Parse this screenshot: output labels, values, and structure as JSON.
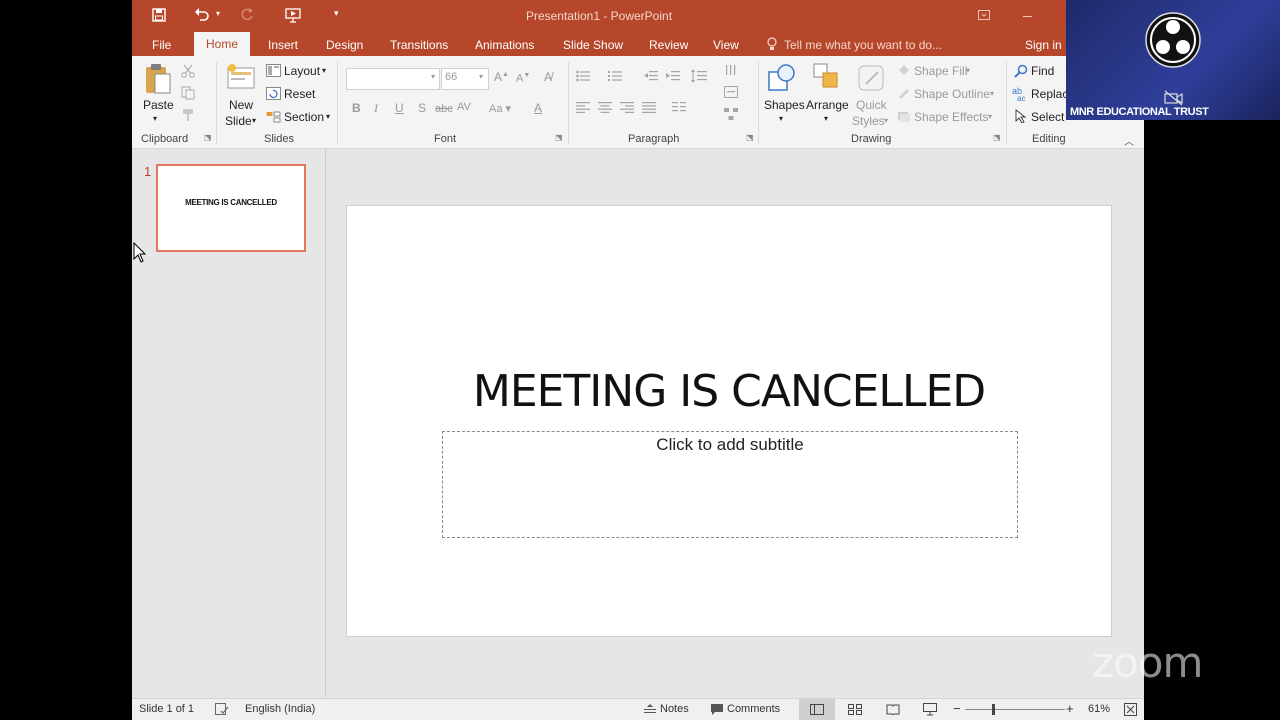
{
  "window": {
    "title": "Presentation1 - PowerPoint",
    "sign_in": "Sign in"
  },
  "tabs": [
    "File",
    "Home",
    "Insert",
    "Design",
    "Transitions",
    "Animations",
    "Slide Show",
    "Review",
    "View"
  ],
  "tell_me": "Tell me what you want to do...",
  "ribbon": {
    "clipboard": {
      "paste": "Paste",
      "label": "Clipboard"
    },
    "slides": {
      "new_slide_1": "New",
      "new_slide_2": "Slide",
      "layout": "Layout",
      "reset": "Reset",
      "section": "Section",
      "label": "Slides"
    },
    "font": {
      "size": "66",
      "label": "Font"
    },
    "paragraph": {
      "label": "Paragraph"
    },
    "drawing": {
      "shapes": "Shapes",
      "arrange": "Arrange",
      "quick_1": "Quick",
      "quick_2": "Styles",
      "shape_fill": "Shape Fill",
      "shape_outline": "Shape Outline",
      "shape_effects": "Shape Effects",
      "label": "Drawing"
    },
    "editing": {
      "find": "Find",
      "replace": "Replac",
      "select": "Select",
      "label": "Editing"
    }
  },
  "thumbnail": {
    "number": "1",
    "text": "MEETING IS CANCELLED"
  },
  "slide": {
    "title": "MEETING IS CANCELLED",
    "subtitle_placeholder": "Click to add subtitle"
  },
  "status": {
    "slide_info": "Slide 1 of 1",
    "language": "English (India)",
    "notes": "Notes",
    "comments": "Comments",
    "zoom": "61%"
  },
  "overlay": {
    "caption": "MNR EDUCATIONAL TRUST",
    "watermark": "zoom"
  },
  "colors": {
    "accent": "#b7472a",
    "ribbon_bg": "#f4f4f4",
    "pane_bg": "#e6e6e6",
    "thumb_border": "#e2795e"
  }
}
